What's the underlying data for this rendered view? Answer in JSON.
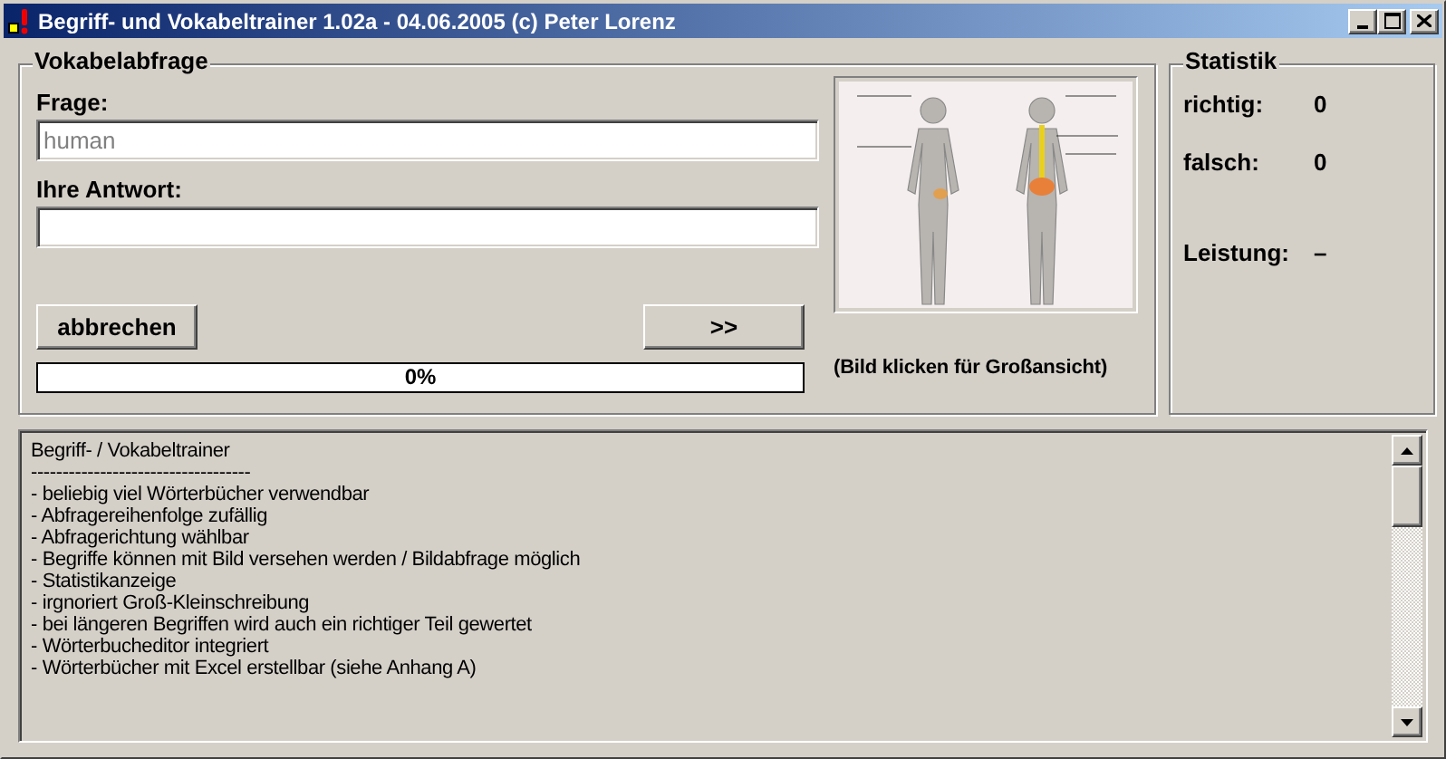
{
  "window": {
    "title": "Begriff- und Vokabeltrainer 1.02a - 04.06.2005 (c) Peter Lorenz"
  },
  "quiz": {
    "legend": "Vokabelabfrage",
    "question_label": "Frage:",
    "question": {
      "value": "human",
      "disabled": true
    },
    "answer_label": "Ihre Antwort:",
    "cancel_button": "abbrechen",
    "next_button": ">>",
    "progress": {
      "level": 0,
      "reading": "0%"
    },
    "image_caption": "(Bild klicken für Großansicht)"
  },
  "statistics": {
    "legend": "Statistik",
    "rows": [
      {
        "label": "richtig:",
        "value": "0"
      },
      {
        "label": "falsch:",
        "value": "0"
      },
      {
        "label": "Leistung:",
        "value": "–"
      }
    ]
  },
  "info_text": {
    "lines": [
      "Begriff- / Vokabeltrainer",
      "-----------------------------------",
      "- beliebig viel Wörterbücher verwendbar",
      "- Abfragereihenfolge zufällig",
      "- Abfragerichtung wählbar",
      "- Begriffe können mit Bild versehen werden / Bildabfrage möglich",
      "- Statistikanzeige",
      "- irgnoriert Groß-Kleinschreibung",
      "- bei längeren Begriffen wird auch ein richtiger Teil gewertet",
      "- Wörterbucheditor integriert",
      "- Wörterbücher mit Excel erstellbar (siehe Anhang A)"
    ]
  }
}
